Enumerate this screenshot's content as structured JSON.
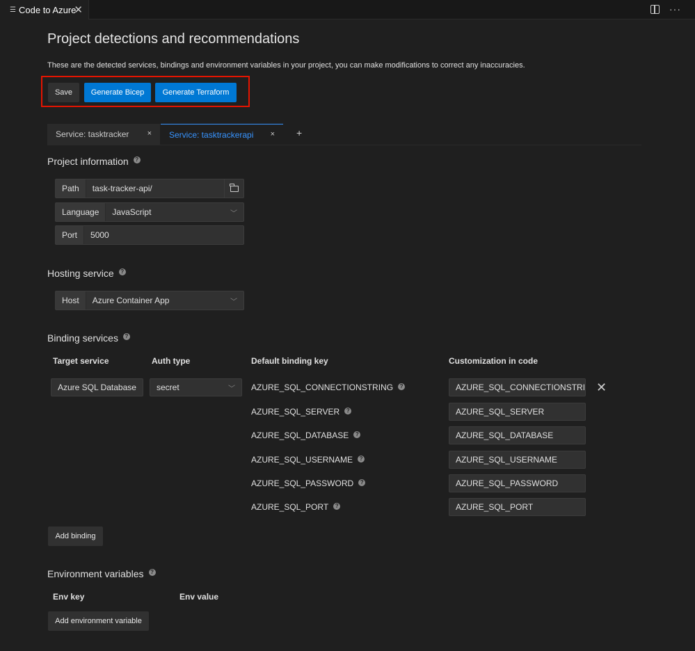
{
  "editor_tab": {
    "title": "Code to Azure",
    "close": "✕"
  },
  "tabbar_actions": {
    "more": "···"
  },
  "page": {
    "title": "Project detections and recommendations",
    "subtitle": "These are the detected services, bindings and environment variables in your project, you can make modifications to correct any inaccuracies."
  },
  "toolbar": {
    "save": "Save",
    "bicep": "Generate Bicep",
    "terraform": "Generate Terraform"
  },
  "service_tabs": [
    {
      "label": "Service: tasktracker",
      "close": "×"
    },
    {
      "label": "Service: tasktrackerapi",
      "close": "×"
    }
  ],
  "service_tabs_add": "+",
  "project_info": {
    "title": "Project information",
    "path_label": "Path",
    "path_value": "task-tracker-api/",
    "language_label": "Language",
    "language_value": "JavaScript",
    "port_label": "Port",
    "port_value": "5000"
  },
  "hosting": {
    "title": "Hosting service",
    "host_label": "Host",
    "host_value": "Azure Container App"
  },
  "binding": {
    "title": "Binding services",
    "headers": {
      "target": "Target service",
      "auth": "Auth type",
      "key": "Default binding key",
      "custom": "Customization in code"
    },
    "target_value": "Azure SQL Database",
    "auth_value": "secret",
    "rows": [
      {
        "key": "AZURE_SQL_CONNECTIONSTRING",
        "custom": "AZURE_SQL_CONNECTIONSTRING"
      },
      {
        "key": "AZURE_SQL_SERVER",
        "custom": "AZURE_SQL_SERVER"
      },
      {
        "key": "AZURE_SQL_DATABASE",
        "custom": "AZURE_SQL_DATABASE"
      },
      {
        "key": "AZURE_SQL_USERNAME",
        "custom": "AZURE_SQL_USERNAME"
      },
      {
        "key": "AZURE_SQL_PASSWORD",
        "custom": "AZURE_SQL_PASSWORD"
      },
      {
        "key": "AZURE_SQL_PORT",
        "custom": "AZURE_SQL_PORT"
      }
    ],
    "add_button": "Add binding"
  },
  "env": {
    "title": "Environment variables",
    "headers": {
      "key": "Env key",
      "value": "Env value"
    },
    "add_button": "Add environment variable"
  },
  "colors": {
    "accent": "#0078d4",
    "highlight": "#e51400",
    "link": "#3794ff"
  }
}
